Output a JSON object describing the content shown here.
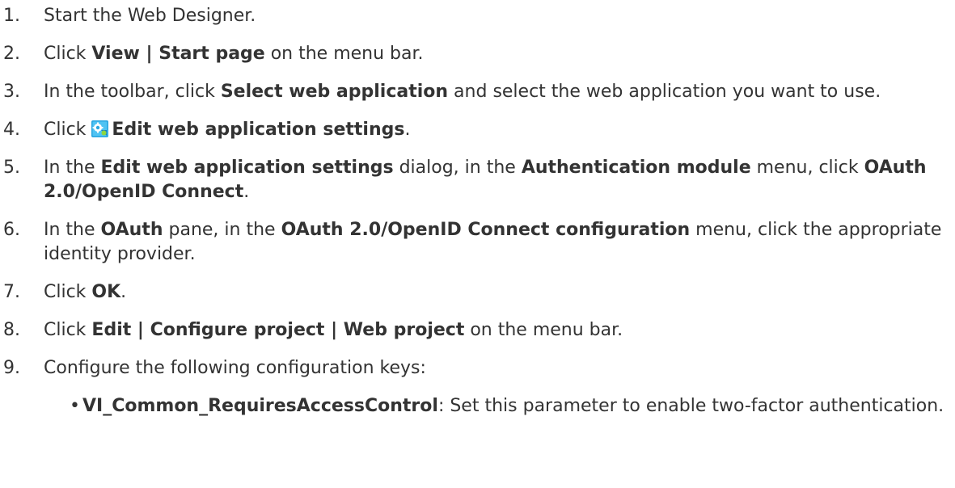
{
  "icons": {
    "settings": "web-application-settings-icon"
  },
  "steps": [
    {
      "num": "1.",
      "parts": [
        "Start the Web Designer."
      ]
    },
    {
      "num": "2.",
      "parts": [
        "Click ",
        "View",
        " | ",
        "Start page",
        " on the menu bar."
      ]
    },
    {
      "num": "3.",
      "parts": [
        "In the toolbar, click ",
        "Select web application",
        " and select the web application you want to use."
      ]
    },
    {
      "num": "4.",
      "parts": [
        "Click ",
        "Edit web application settings",
        "."
      ]
    },
    {
      "num": "5.",
      "parts": [
        "In the ",
        "Edit web application settings",
        " dialog, in the ",
        "Authentication module",
        " menu, click ",
        "OAuth 2.0/OpenID Connect",
        "."
      ]
    },
    {
      "num": "6.",
      "parts": [
        "In the ",
        "OAuth",
        " pane, in the ",
        "OAuth 2.0/OpenID Connect configuration",
        " menu, click the appropriate identity provider."
      ]
    },
    {
      "num": "7.",
      "parts": [
        "Click ",
        "OK",
        "."
      ]
    },
    {
      "num": "8.",
      "parts": [
        "Click ",
        "Edit",
        " | ",
        "Configure project",
        " | ",
        "Web project",
        " on the menu bar."
      ]
    },
    {
      "num": "9.",
      "parts": [
        "Configure the following configuration keys:"
      ]
    }
  ],
  "sub_items": [
    {
      "bullet": "•",
      "parts": [
        "VI_Common_RequiresAccessControl",
        ": Set this parameter to enable two-factor authentication."
      ]
    }
  ]
}
